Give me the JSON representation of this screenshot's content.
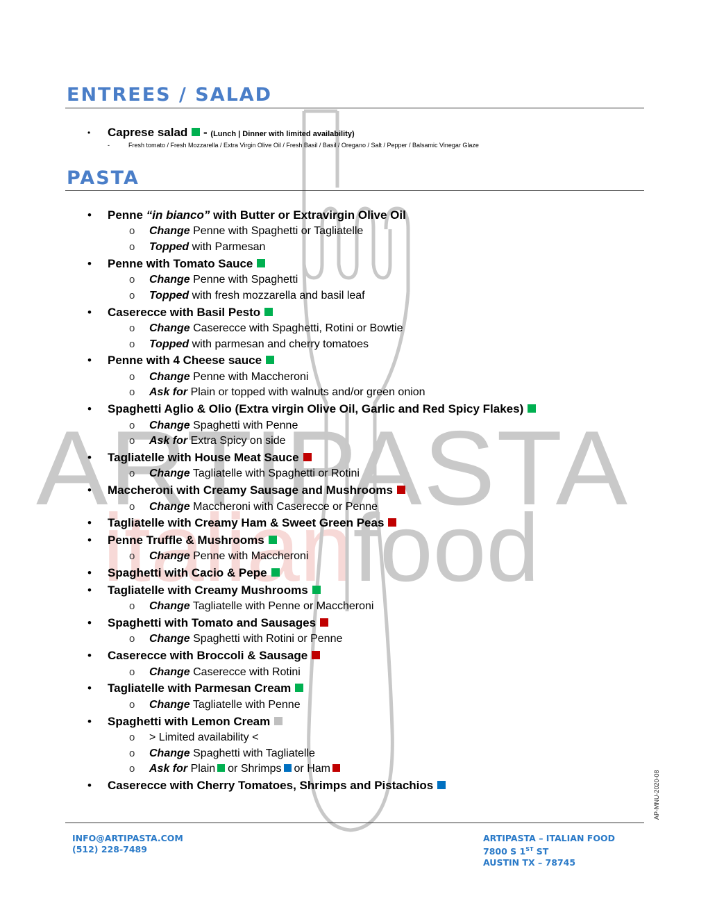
{
  "colors": {
    "heading": "#4a7ec8",
    "footer": "#2a7ac8",
    "vegetarian": "#00b050",
    "meat": "#c00000",
    "seafood": "#0070c0",
    "limited": "#bfbfbf",
    "watermark_gray": "#c9c9c9",
    "watermark_pink": "#f7d9d7"
  },
  "watermark": {
    "line1": "ARTIPASTA",
    "line2_italic_part": "italian",
    "line2_rest": "food",
    "icon": "fork-icon"
  },
  "entrees": {
    "title": "ENTREES / SALAD",
    "items": [
      {
        "name": "Caprese salad",
        "marker": "vegetarian",
        "separator": " - ",
        "note": "(Lunch | Dinner with limited availability)",
        "ingredients_dash": "-",
        "ingredients": "Fresh tomato / Fresh Mozzarella / Extra Virgin Olive Oil / Fresh Basil / Basil / Oregano / Salt / Pepper / Balsamic Vinegar Glaze"
      }
    ]
  },
  "pasta": {
    "title": "PASTA",
    "bullet": "•",
    "sub_bullet": "o",
    "items": [
      {
        "name_pre": "Penne ",
        "name_italic": "“in bianco”",
        "name_post": " with Butter or Extravirgin Olive Oil",
        "marker": null,
        "subs": [
          {
            "label": "Change",
            "text": " Penne with Spaghetti or Tagliatelle"
          },
          {
            "label": "Topped",
            "text": " with Parmesan"
          }
        ]
      },
      {
        "name": "Penne with Tomato Sauce",
        "marker": "vegetarian",
        "subs": [
          {
            "label": "Change",
            "text": " Penne with Spaghetti"
          },
          {
            "label": "Topped",
            "text": " with fresh mozzarella and basil leaf"
          }
        ]
      },
      {
        "name": "Caserecce with Basil Pesto",
        "marker": "vegetarian",
        "subs": [
          {
            "label": "Change",
            "text": " Caserecce with Spaghetti, Rotini or Bowtie"
          },
          {
            "label": "Topped",
            "text": " with parmesan and cherry tomatoes"
          }
        ]
      },
      {
        "name": "Penne with 4 Cheese sauce",
        "marker": "vegetarian",
        "subs": [
          {
            "label": "Change",
            "text": " Penne with Maccheroni"
          },
          {
            "label": "Ask for",
            "text": " Plain or topped with walnuts and/or green onion"
          }
        ]
      },
      {
        "name": "Spaghetti Aglio & Olio (Extra virgin Olive Oil, Garlic and Red Spicy Flakes)",
        "marker": "vegetarian",
        "subs": [
          {
            "label": "Change",
            "text": " Spaghetti with Penne"
          },
          {
            "label": "Ask for",
            "text": " Extra Spicy on side"
          }
        ]
      },
      {
        "name": "Tagliatelle with House Meat Sauce",
        "marker": "meat",
        "subs": [
          {
            "label": "Change",
            "text": " Tagliatelle with Spaghetti or Rotini"
          }
        ]
      },
      {
        "name": "Maccheroni with Creamy Sausage and Mushrooms",
        "marker": "meat",
        "subs": [
          {
            "label": "Change",
            "text": " Maccheroni with Caserecce or Penne"
          }
        ]
      },
      {
        "name": "Tagliatelle with Creamy Ham & Sweet Green Peas",
        "marker": "meat",
        "subs": []
      },
      {
        "name": "Penne Truffle & Mushrooms",
        "marker": "vegetarian",
        "subs": [
          {
            "label": "Change",
            "text": " Penne with Maccheroni"
          }
        ]
      },
      {
        "name": "Spaghetti with Cacio & Pepe",
        "marker": "vegetarian",
        "subs": []
      },
      {
        "name": "Tagliatelle with Creamy Mushrooms",
        "marker": "vegetarian",
        "subs": [
          {
            "label": "Change",
            "text": " Tagliatelle with Penne or Maccheroni"
          }
        ]
      },
      {
        "name": "Spaghetti with Tomato and Sausages",
        "marker": "meat",
        "subs": [
          {
            "label": "Change",
            "text": " Spaghetti with Rotini or Penne"
          }
        ]
      },
      {
        "name": "Caserecce with Broccoli & Sausage",
        "marker": "meat",
        "subs": [
          {
            "label": "Change",
            "text": " Caserecce with Rotini"
          }
        ]
      },
      {
        "name": "Tagliatelle with Parmesan Cream",
        "marker": "vegetarian",
        "subs": [
          {
            "label": "Change",
            "text": " Tagliatelle with Penne"
          }
        ]
      },
      {
        "name": "Spaghetti with Lemon Cream",
        "marker": "limited",
        "subs": [
          {
            "label": "",
            "text": "> Limited availability <"
          },
          {
            "label": "Change",
            "text": " Spaghetti with Tagliatelle"
          },
          {
            "label": "Ask for",
            "options": [
              {
                "text": " Plain",
                "marker": "vegetarian"
              },
              {
                "text": "or Shrimps",
                "marker": "seafood"
              },
              {
                "text": "or Ham",
                "marker": "meat"
              }
            ]
          }
        ]
      },
      {
        "name": "Caserecce with Cherry Tomatoes, Shrimps and Pistachios",
        "marker": "seafood",
        "subs": []
      }
    ]
  },
  "doc_code": "AP-MNU-2020-08",
  "footer": {
    "email": "INFO@ARTIPASTA.COM",
    "phone": "(512) 228-7489",
    "business": "ARTIPASTA – ITALIAN FOOD",
    "address_line1_pre": "7800 S 1",
    "address_line1_sup": "ST",
    "address_line1_post": " ST",
    "address_line2": "AUSTIN TX – 78745"
  }
}
